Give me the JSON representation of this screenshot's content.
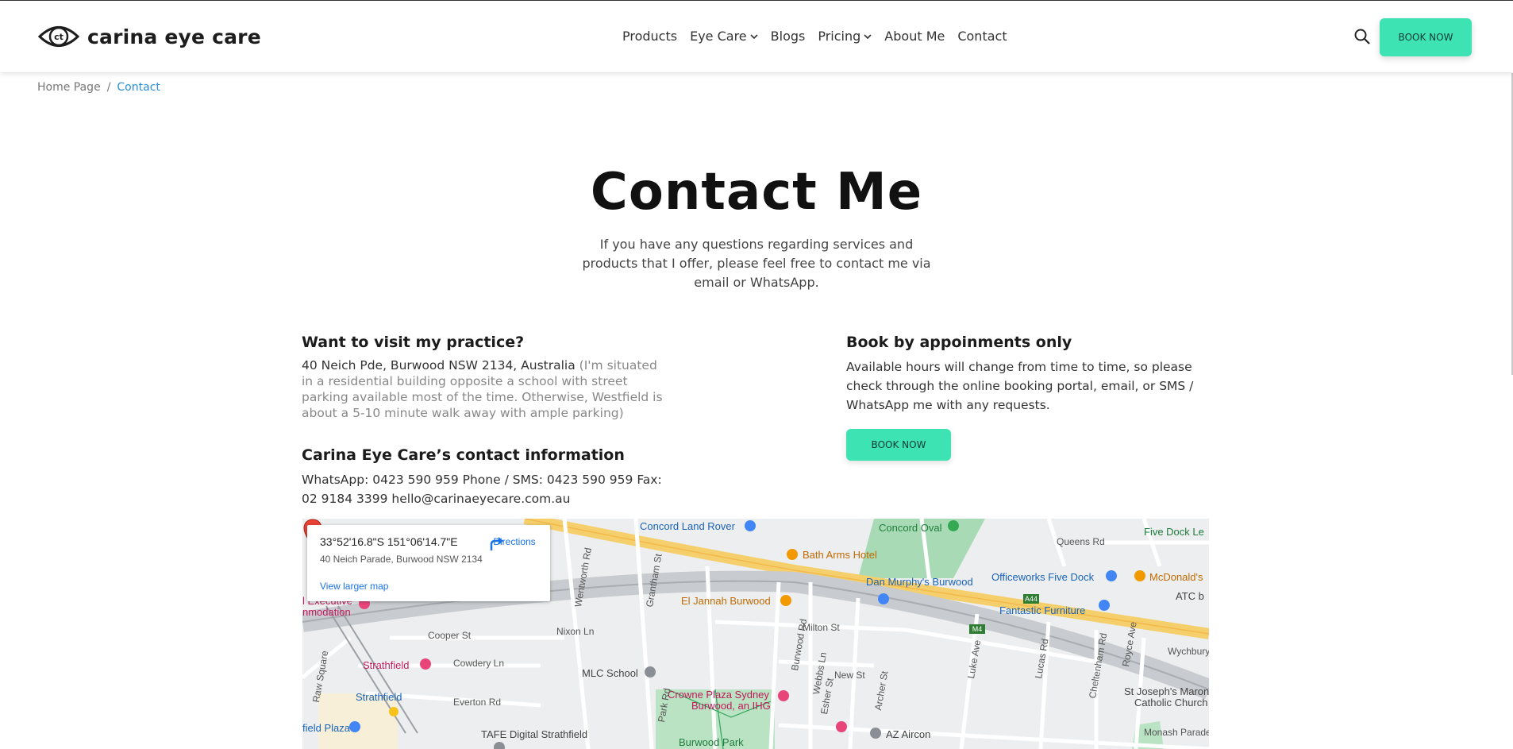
{
  "brand": {
    "name": "carina eye care",
    "logo_letters": "ct"
  },
  "nav": {
    "items": [
      {
        "label": "Products",
        "dropdown": false
      },
      {
        "label": "Eye Care",
        "dropdown": true
      },
      {
        "label": "Blogs",
        "dropdown": false
      },
      {
        "label": "Pricing",
        "dropdown": true
      },
      {
        "label": "About Me",
        "dropdown": false
      },
      {
        "label": "Contact",
        "dropdown": false
      }
    ],
    "search_icon": "search-icon",
    "book_label": "BOOK NOW"
  },
  "colors": {
    "accent": "#3ee3b4",
    "link": "#2a8fd6",
    "text": "#1b1b1b"
  },
  "breadcrumb": {
    "home": "Home Page",
    "separator": "/",
    "current": "Contact"
  },
  "page": {
    "title": "Contact Me",
    "subtitle": "If you have any questions regarding services and products that I offer, please feel free to contact me via email or WhatsApp."
  },
  "visit": {
    "heading": "Want to visit my practice?",
    "address": "40 Neich Pde, Burwood NSW 2134, Australia",
    "note": "(I'm situated in a residential building opposite a school with street parking available most of the time. Otherwise, Westfield is about a 5-10 minute walk away with ample parking)"
  },
  "contact_info": {
    "heading": "Carina Eye Care’s contact information",
    "text": "WhatsApp: 0423 590 959 Phone / SMS: 0423 590 959 Fax: 02 9184 3399 hello@carinaeyecare.com.au"
  },
  "appointments": {
    "heading": "Book by appoinments only",
    "text": "Available hours will change from time to time, so please check through the online booking portal, email, or SMS / WhatsApp me with any requests.",
    "book_label": "BOOK NOW"
  },
  "map": {
    "coordinates": "33°52'16.8\"S 151°06'14.7\"E",
    "address": "40 Neich Parade, Burwood NSW 2134",
    "directions_label": "Directions",
    "larger_map_label": "View larger map",
    "pois": {
      "concord_land_rover": "Concord Land Rover",
      "concord_oval": "Concord Oval",
      "queens_rd": "Queens Rd",
      "five_dock": "Five Dock Le",
      "bath_arms": "Bath Arms Hotel",
      "dan_murphys": "Dan Murphy's Burwood",
      "officeworks": "Officeworks Five Dock",
      "mcdonalds": "McDonald's",
      "atc": "ATC b",
      "el_jannah": "El Jannah Burwood",
      "fantastic": "Fantastic Furniture",
      "executive": "l Executive",
      "nmodation": "nmodation",
      "strathfield_pink": "Strathfield",
      "strathfield_station": "Strathfield",
      "field_plaza": "field Plaza",
      "mlc_school": "MLC School",
      "crowne_plaza_1": "Crowne Plaza Sydney",
      "crowne_plaza_2": "Burwood, an IHG",
      "tafe": "TAFE Digital Strathfield",
      "burwood_park": "Burwood Park",
      "az_aircon": "AZ Aircon",
      "st_josephs_1": "St Joseph's Maronite",
      "st_josephs_2": "Catholic Church",
      "monash": "Monash Parade",
      "wychbury": "Wychbury",
      "a44": "A44",
      "m4": "M4"
    },
    "roads": {
      "cooper": "Cooper St",
      "cowdery": "Cowdery Ln",
      "everton": "Everton Rd",
      "nixon": "Nixon Ln",
      "milton": "Milton St",
      "new_st": "New St",
      "raw_square": "Raw Square",
      "wentworth": "Wentworth Rd",
      "grantham": "Grantham St",
      "burwood_rd": "Burwood Rd",
      "webbs": "Webbs Ln",
      "esher": "Esher St",
      "archer": "Archer St",
      "luke": "Luke Ave",
      "lucas": "Lucas Rd",
      "cheltenham": "Cheltenham Rd",
      "royce": "Royce Ave",
      "park_rd": "Park Rd"
    }
  }
}
